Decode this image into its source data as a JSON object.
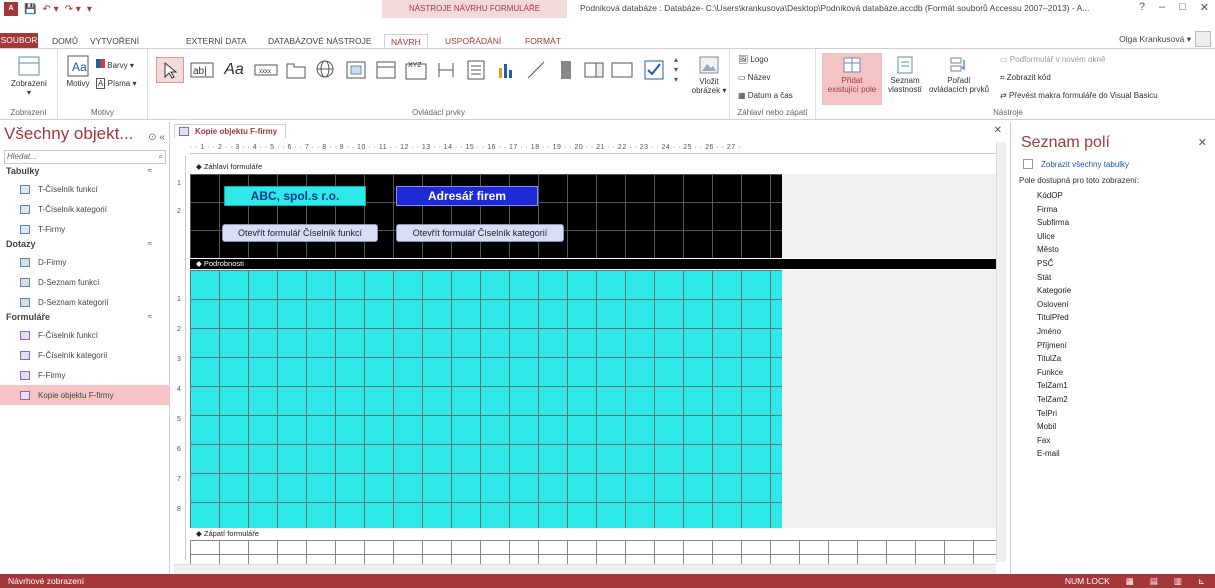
{
  "titlebar": {
    "app_icon": "A",
    "context_title": "NÁSTROJE NÁVRHU FORMULÁŘE",
    "window_title": "Podniková databáze : Databáze- C:\\Users\\krankusova\\Desktop\\Podniková databáze.accdb (Formát souborů Accessu 2007–2013) - A...",
    "controls": [
      "?",
      "–",
      "□",
      "✕"
    ]
  },
  "tabs": {
    "file": "SOUBOR",
    "home": "DOMŮ",
    "create": "VYTVOŘENÍ",
    "external": "EXTERNÍ DATA",
    "dbtools": "DATABÁZOVÉ NÁSTROJE",
    "design": "NÁVRH",
    "arrange": "USPOŘÁDÁNÍ",
    "format": "FORMÁT"
  },
  "user": {
    "name": "Olga Krankusová ▾"
  },
  "ribbon": {
    "views": {
      "button": "Zobrazení",
      "group": "Zobrazení"
    },
    "themes": {
      "motivy": "Motivy",
      "barvy": "Barvy ▾",
      "pisma": "Písma ▾",
      "group": "Motivy"
    },
    "controls": {
      "group": "Ovládací prvky",
      "vlozit": "Vložit",
      "obrazek": "obrázek ▾"
    },
    "header_footer": {
      "logo": "Logo",
      "nazev": "Název",
      "datum": "Datum a čas",
      "group": "Záhlaví nebo zápatí"
    },
    "tools": {
      "pridat1": "Přidat",
      "pridat2": "existující pole",
      "seznam1": "Seznam",
      "seznam2": "vlastností",
      "poradi1": "Pořadí",
      "poradi2": "ovládacích prvků",
      "podformular": "Podformulář v novém okně",
      "zobrazit_kod": "Zobrazit kód",
      "prevest": "Převést makra formuláře do Visual Basicu",
      "group": "Nástroje"
    }
  },
  "nav": {
    "title": "Všechny objekt...",
    "search_placeholder": "Hledat...",
    "groups": [
      {
        "label": "Tabulky",
        "items": [
          "T-Číselník funkcí",
          "T-Číselník kategorií",
          "T-Firmy"
        ]
      },
      {
        "label": "Dotazy",
        "items": [
          "D-Firmy",
          "D-Seznam funkcí",
          "D-Seznam kategorií"
        ]
      },
      {
        "label": "Formuláře",
        "items": [
          "F-Číselník funkcí",
          "F-Číselník kategorií",
          "F-Firmy",
          "Kopie objektu F-firmy"
        ]
      }
    ]
  },
  "document": {
    "tab_label": "Kopie objektu F-firmy",
    "ruler": "· · 1 · · 2 · · 3 · · 4 · · 5 · · 6 · · 7 · · 8 · · 9 · · 10 · · 11 · · 12 · · 13 · · 14 · · 15 · · 16 · · 17 · · 18 · · 19 · · 20 · · 21 · · 22 · · 23 · · 24 · · 25 · · 26 · · 27 ·",
    "header_section": "Záhlaví formuláře",
    "detail_section": "Podrobnosti",
    "footer_section": "Zápatí formuláře",
    "label_company": "ABC, spol.s r.o.",
    "label_title": "Adresář firem",
    "button_functions": "Otevřít formulář Číselník funkcí",
    "button_categories": "Otevřít formulář Číselník kategorií"
  },
  "fieldlist": {
    "title": "Seznam polí",
    "show_all": "Zobrazit všechny tabulky",
    "available": "Pole dostupná pro toto zobrazení:",
    "fields": [
      "KódOP",
      "Firma",
      "Subfirma",
      "Ulice",
      "Město",
      "PSČ",
      "Stát",
      "Kategorie",
      "Oslovení",
      "TitulPřed",
      "Jméno",
      "Příjmení",
      "TitulZa",
      "Funkce",
      "TelZam1",
      "TelZam2",
      "TelPri",
      "Mobil",
      "Fax",
      "E-mail"
    ]
  },
  "status": {
    "left": "Návrhové zobrazení",
    "numlock": "NUM LOCK"
  },
  "colors": {
    "accent": "#a4373a",
    "detail": "#2fe8e8",
    "title_label": "#1e2bd4"
  }
}
